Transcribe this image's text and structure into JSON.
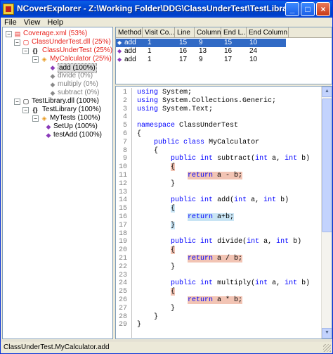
{
  "window": {
    "title": "NCoverExplorer - Z:\\Working Folder\\DDG\\ClassUnderTest\\TestLibrary\\bin\\Debug\\Cove..."
  },
  "menu": {
    "file": "File",
    "view": "View",
    "help": "Help"
  },
  "tree": {
    "coverage": "Coverage.xml (53%)",
    "dll_cut": "ClassUnderTest.dll (25%)",
    "ns_cut": "ClassUnderTest (25%)",
    "class_mycalc": "MyCalculator (25%)",
    "m_add": "add (100%)",
    "m_divide": "divide (0%)",
    "m_multiply": "multiply (0%)",
    "m_subtract": "subtract (0%)",
    "dll_test": "TestLibrary.dll (100%)",
    "ns_test": "TestLibrary (100%)",
    "class_mytests": "MyTests (100%)",
    "m_setup": "SetUp (100%)",
    "m_testadd": "testAdd (100%)"
  },
  "grid": {
    "headers": [
      "Method",
      "Visit Co...",
      "Line",
      "Column",
      "End L...",
      "End Column"
    ],
    "rows": [
      [
        "add",
        "1",
        "15",
        "9",
        "15",
        "10"
      ],
      [
        "add",
        "1",
        "16",
        "13",
        "16",
        "24"
      ],
      [
        "add",
        "1",
        "17",
        "9",
        "17",
        "10"
      ]
    ]
  },
  "code": {
    "lines": [
      {
        "n": "1",
        "t": "using System;"
      },
      {
        "n": "2",
        "t": "using System.Collections.Generic;"
      },
      {
        "n": "3",
        "t": "using System.Text;"
      },
      {
        "n": "4",
        "t": ""
      },
      {
        "n": "5",
        "t": "namespace ClassUnderTest"
      },
      {
        "n": "6",
        "t": "{"
      },
      {
        "n": "7",
        "t": "    public class MyCalculator"
      },
      {
        "n": "8",
        "t": "    {"
      },
      {
        "n": "9",
        "t": "        public int subtract(int a, int b)"
      },
      {
        "n": "10",
        "t": "        {"
      },
      {
        "n": "11",
        "t": "            return a - b;"
      },
      {
        "n": "12",
        "t": "        }"
      },
      {
        "n": "13",
        "t": ""
      },
      {
        "n": "14",
        "t": "        public int add(int a, int b)"
      },
      {
        "n": "15",
        "t": "        {"
      },
      {
        "n": "16",
        "t": "            return a+b;"
      },
      {
        "n": "17",
        "t": "        }"
      },
      {
        "n": "18",
        "t": ""
      },
      {
        "n": "19",
        "t": "        public int divide(int a, int b)"
      },
      {
        "n": "20",
        "t": "        {"
      },
      {
        "n": "21",
        "t": "            return a / b;"
      },
      {
        "n": "22",
        "t": "        }"
      },
      {
        "n": "23",
        "t": ""
      },
      {
        "n": "24",
        "t": "        public int multiply(int a, int b)"
      },
      {
        "n": "25",
        "t": "        {"
      },
      {
        "n": "26",
        "t": "            return a * b;"
      },
      {
        "n": "27",
        "t": "        }"
      },
      {
        "n": "28",
        "t": "    }"
      },
      {
        "n": "29",
        "t": "}"
      }
    ]
  },
  "status": {
    "text": "ClassUnderTest.MyCalculator.add"
  },
  "colors": {
    "uncovered": "#f2c4b4",
    "covered": "#c8e4f4",
    "keyword": "#0000ff",
    "uncovered_text": "#e8241e"
  }
}
